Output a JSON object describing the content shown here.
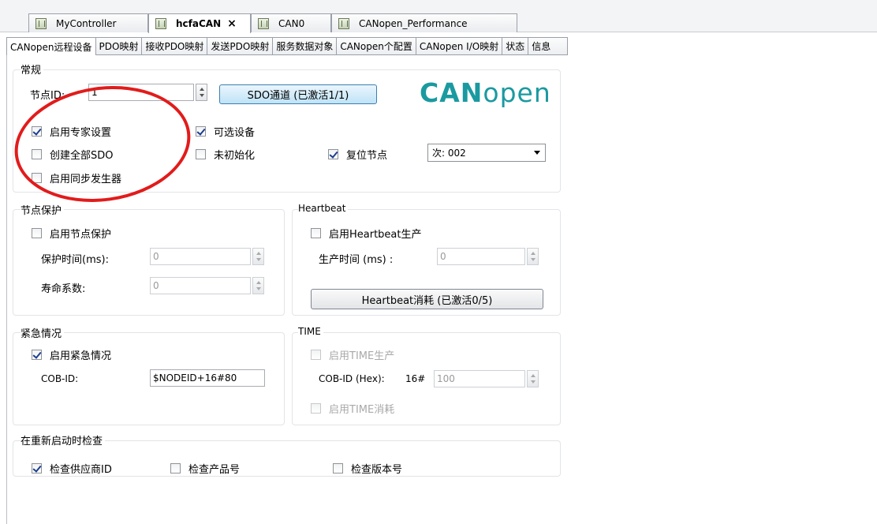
{
  "doc_tabs": [
    {
      "label": "MyController",
      "active": false
    },
    {
      "label": "hcfaCAN",
      "active": true
    },
    {
      "label": "CAN0",
      "active": false
    },
    {
      "label": "CANopen_Performance",
      "active": false
    }
  ],
  "close_glyph": "×",
  "sub_tabs": [
    "CANopen远程设备",
    "PDO映射",
    "接收PDO映射",
    "发送PDO映射",
    "服务数据对象",
    "CANopen个配置",
    "CANopen I/O映射",
    "状态",
    "信息"
  ],
  "general": {
    "title": "常规",
    "node_id_label": "节点ID:",
    "node_id_value": "1",
    "sdo_button": "SDO通道 (已激活1/1)",
    "logo_bold": "CAN",
    "logo_light": "open",
    "expert": {
      "label": "启用专家设置",
      "checked": true
    },
    "create_sdo": {
      "label": "创建全部SDO",
      "checked": false
    },
    "sync_gen": {
      "label": "启用同步发生器",
      "checked": false
    },
    "optional": {
      "label": "可选设备",
      "checked": true
    },
    "uninit": {
      "label": "未初始化",
      "checked": false
    },
    "reset_node": {
      "label": "复位节点",
      "checked": true
    },
    "reset_select": "次: 002"
  },
  "nodeguard": {
    "title": "节点保护",
    "enable": {
      "label": "启用节点保护",
      "checked": false
    },
    "guard_time_label": "保护时间(ms):",
    "guard_time_value": "0",
    "life_factor_label": "寿命系数:",
    "life_factor_value": "0"
  },
  "heartbeat": {
    "title": "Heartbeat",
    "enable": {
      "label": "启用Heartbeat生产",
      "checked": false
    },
    "prod_time_label": "生产时间 (ms) :",
    "prod_time_value": "0",
    "consume_button": "Heartbeat消耗 (已激活0/5)"
  },
  "emergency": {
    "title": "紧急情况",
    "enable": {
      "label": "启用紧急情况",
      "checked": true
    },
    "cobid_label": "COB-ID:",
    "cobid_value": "$NODEID+16#80"
  },
  "time": {
    "title": "TIME",
    "enable_prod": {
      "label": "启用TIME生产",
      "checked": false
    },
    "cobid_label": "COB-ID (Hex):",
    "hex_prefix": "16#",
    "cobid_value": "100",
    "enable_cons": {
      "label": "启用TIME消耗",
      "checked": false
    }
  },
  "restart": {
    "title": "在重新启动时检查",
    "vendor": {
      "label": "检查供应商ID",
      "checked": true
    },
    "product": {
      "label": "检查产品号",
      "checked": false
    },
    "revision": {
      "label": "检查版本号",
      "checked": false
    }
  },
  "colors": {
    "annotation": "#e21b1b",
    "logo": "#1a9aa0"
  }
}
